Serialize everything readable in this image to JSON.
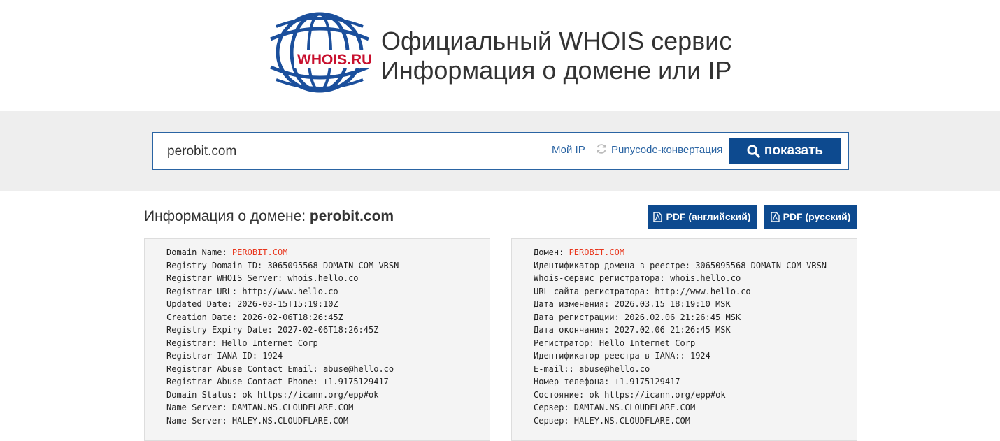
{
  "header": {
    "logo_text": "WHOIS.RU",
    "slogan_line1": "Официальный WHOIS сервис",
    "slogan_line2": "Информация о домене или IP"
  },
  "search": {
    "value": "perobit.com",
    "my_ip_label": "Мой IP",
    "punycode_label": "Punycode-конвертация",
    "submit_label": "показать",
    "submit_icon": "search-icon",
    "refresh_icon": "refresh-icon"
  },
  "info": {
    "title_prefix": "Информация о домене: ",
    "domain": "perobit.com",
    "pdf_en_label": "PDF (английский)",
    "pdf_ru_label": "PDF (русский)"
  },
  "whois_en": [
    {
      "label": "Domain Name: ",
      "value": "PEROBIT.COM"
    },
    {
      "label": "Registry Domain ID: ",
      "value": "3065095568_DOMAIN_COM-VRSN"
    },
    {
      "label": "Registrar WHOIS Server: ",
      "value": "whois.hello.co"
    },
    {
      "label": "Registrar URL: ",
      "value": "http://www.hello.co"
    },
    {
      "label": "Updated Date: ",
      "value": "2026-03-15T15:19:10Z"
    },
    {
      "label": "Creation Date: ",
      "value": "2026-02-06T18:26:45Z"
    },
    {
      "label": "Registry Expiry Date: ",
      "value": "2027-02-06T18:26:45Z"
    },
    {
      "label": "Registrar: ",
      "value": "Hello Internet Corp"
    },
    {
      "label": "Registrar IANA ID: ",
      "value": "1924"
    },
    {
      "label": "Registrar Abuse Contact Email: ",
      "value": "abuse@hello.co"
    },
    {
      "label": "Registrar Abuse Contact Phone: ",
      "value": "+1.9175129417"
    },
    {
      "label": "Domain Status: ",
      "value": "ok https://icann.org/epp#ok"
    },
    {
      "label": "Name Server: ",
      "value": "DAMIAN.NS.CLOUDFLARE.COM"
    },
    {
      "label": "Name Server: ",
      "value": "HALEY.NS.CLOUDFLARE.COM"
    }
  ],
  "whois_ru": [
    {
      "label": "Домен: ",
      "value": "PEROBIT.COM"
    },
    {
      "label": "Идентификатор домена в реестре: ",
      "value": "3065095568_DOMAIN_COM-VRSN"
    },
    {
      "label": "Whois-сервис регистратора: ",
      "value": "whois.hello.co"
    },
    {
      "label": "URL сайта регистратора: ",
      "value": "http://www.hello.co"
    },
    {
      "label": "Дата изменения: ",
      "value": "2026.03.15 18:19:10 MSK"
    },
    {
      "label": "Дата регистрации: ",
      "value": "2026.02.06 21:26:45 MSK"
    },
    {
      "label": "Дата окончания: ",
      "value": "2027.02.06 21:26:45 MSK"
    },
    {
      "label": "Регистратор: ",
      "value": "Hello Internet Corp"
    },
    {
      "label": "Идентификатор реестра в IANA:: ",
      "value": "1924"
    },
    {
      "label": "E-mail:: ",
      "value": "abuse@hello.co"
    },
    {
      "label": "Номер телефона: ",
      "value": "+1.9175129417"
    },
    {
      "label": "Состояние: ",
      "value": "ok https://icann.org/epp#ok"
    },
    {
      "label": "Сервер: ",
      "value": "DAMIAN.NS.CLOUDFLARE.COM"
    },
    {
      "label": "Сервер: ",
      "value": "HALEY.NS.CLOUDFLARE.COM"
    }
  ],
  "colors": {
    "brand_blue": "#0d4a8f",
    "link_blue": "#2a64a3",
    "highlight_red": "#e8361d",
    "logo_red": "#c8102e"
  }
}
